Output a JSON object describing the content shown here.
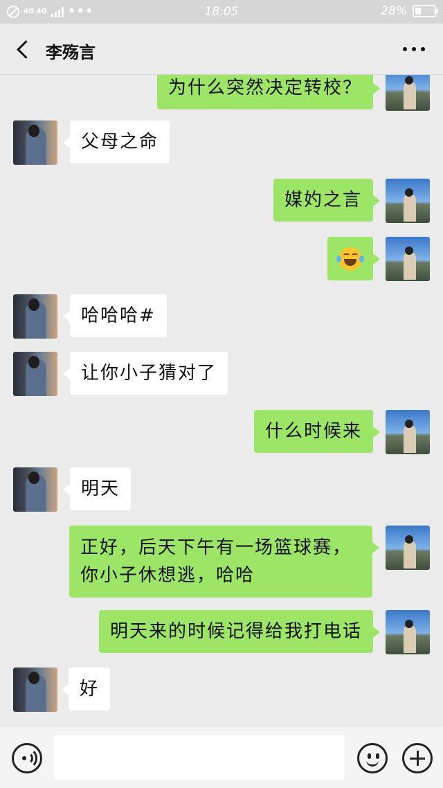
{
  "status_bar": {
    "network": "4G 4G",
    "dots": "•••",
    "time": "18:05",
    "battery_text": "28%"
  },
  "header": {
    "title": "李殇言",
    "back_icon": "chevron-left-icon",
    "more_icon": "more-dots-icon"
  },
  "messages": [
    {
      "side": "right",
      "text": "为什么突然决定转校？"
    },
    {
      "side": "left",
      "text": "父母之命"
    },
    {
      "side": "right",
      "text": "媒妁之言"
    },
    {
      "side": "right",
      "emoji": "laughing-tears-emoji"
    },
    {
      "side": "left",
      "text": "哈哈哈#"
    },
    {
      "side": "left",
      "text": "让你小子猜对了"
    },
    {
      "side": "right",
      "text": "什么时候来"
    },
    {
      "side": "left",
      "text": "明天"
    },
    {
      "side": "right",
      "text": "正好，后天下午有一场篮球赛，你小子休想逃，哈哈"
    },
    {
      "side": "right",
      "text": "明天来的时候记得给我打电话"
    },
    {
      "side": "left",
      "text": "好"
    }
  ],
  "input_bar": {
    "voice_icon": "voice-icon",
    "input_value": "",
    "input_placeholder": "",
    "emoji_icon": "emoji-icon",
    "plus_icon": "plus-icon"
  },
  "colors": {
    "sent_bubble": "#9de567",
    "received_bubble": "#ffffff",
    "background": "#ebebeb"
  }
}
